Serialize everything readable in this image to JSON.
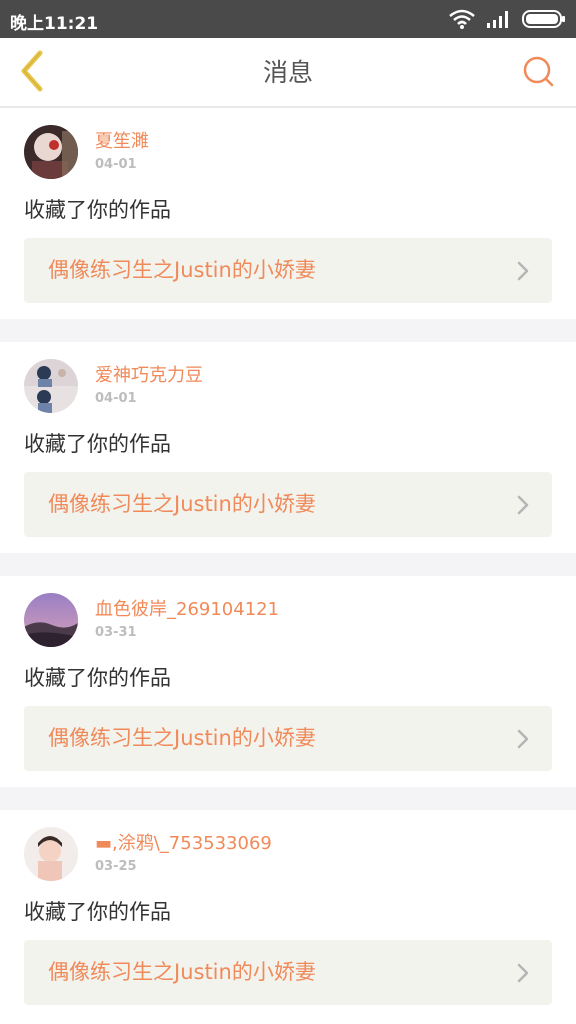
{
  "status_bar": {
    "time": "晚上11:21",
    "icons": [
      "wifi-icon",
      "signal-icon",
      "battery-icon"
    ]
  },
  "header": {
    "title": "消息",
    "back_icon": "chevron-left-icon",
    "search_icon": "search-icon"
  },
  "colors": {
    "accent": "#f08a5a",
    "back_icon": "#e8c547",
    "card_link_bg": "#f3f3ee",
    "separator": "#f4f3f5"
  },
  "messages": [
    {
      "username": "夏笙濉",
      "date": "04-01",
      "action": "收藏了你的作品",
      "work_title": "偶像练习生之Justin的小娇妻"
    },
    {
      "username": "爱神巧克力豆",
      "date": "04-01",
      "action": "收藏了你的作品",
      "work_title": "偶像练习生之Justin的小娇妻"
    },
    {
      "username": "血色彼岸_269104121",
      "date": "03-31",
      "action": "收藏了你的作品",
      "work_title": "偶像练习生之Justin的小娇妻"
    },
    {
      "username": "▬,涂鸦\\_753533069",
      "date": "03-25",
      "action": "收藏了你的作品",
      "work_title": "偶像练习生之Justin的小娇妻"
    }
  ]
}
